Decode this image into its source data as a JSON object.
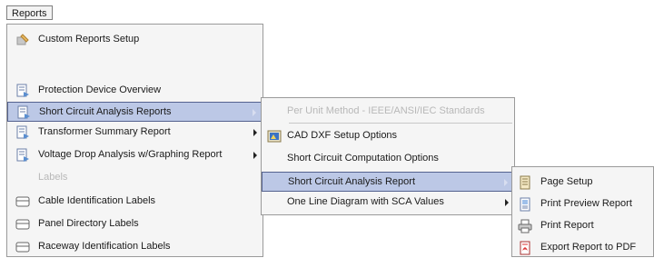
{
  "menubar": {
    "reports": "Reports"
  },
  "reports_menu": {
    "items": [
      {
        "label": "Custom Reports Setup",
        "icon": "custom-reports-icon"
      },
      {
        "label": "Protection Device Overview",
        "icon": "report-icon"
      },
      {
        "label": "Short Circuit Analysis Reports",
        "icon": "report-icon"
      },
      {
        "label": "Transformer Summary Report",
        "icon": "report-icon"
      },
      {
        "label": "Voltage Drop Analysis w/Graphing Report",
        "icon": "report-icon"
      },
      {
        "label": "Labels"
      },
      {
        "label": "Cable Identification Labels",
        "icon": "label-icon"
      },
      {
        "label": "Panel Directory Labels",
        "icon": "label-icon"
      },
      {
        "label": "Raceway Identification Labels",
        "icon": "label-icon"
      }
    ]
  },
  "sca_submenu": {
    "items": [
      {
        "label": "Per Unit Method - IEEE/ANSI/IEC Standards"
      },
      {
        "label": "CAD DXF Setup Options",
        "icon": "cad-icon"
      },
      {
        "label": "Short Circuit Computation Options"
      },
      {
        "label": "Short Circuit Analysis Report"
      },
      {
        "label": "One Line Diagram with SCA Values"
      }
    ]
  },
  "report_submenu": {
    "items": [
      {
        "label": "Page Setup",
        "icon": "page-setup-icon"
      },
      {
        "label": "Print Preview Report",
        "icon": "print-preview-icon"
      },
      {
        "label": "Print Report",
        "icon": "printer-icon"
      },
      {
        "label": "Export Report to PDF",
        "icon": "pdf-icon"
      }
    ]
  },
  "colors": {
    "highlight": "#bcc8e6",
    "highlight_border": "#55628f",
    "disabled": "#b8b8b8"
  }
}
